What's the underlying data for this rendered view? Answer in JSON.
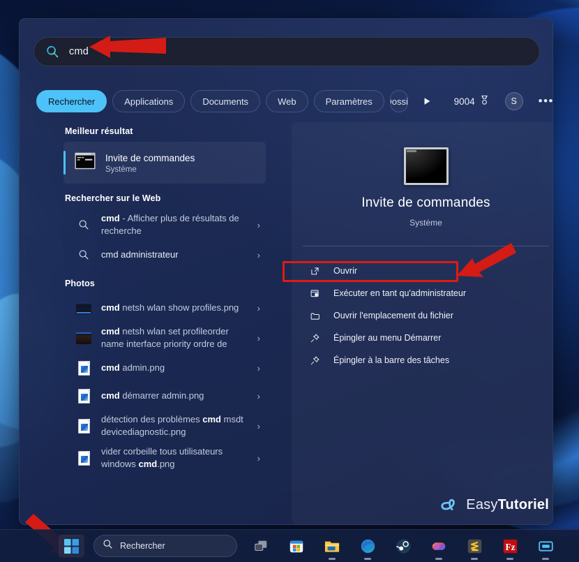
{
  "search": {
    "value": "cmd",
    "icon": "search-icon"
  },
  "tabs": [
    {
      "label": "Rechercher",
      "active": true
    },
    {
      "label": "Applications",
      "active": false
    },
    {
      "label": "Documents",
      "active": false
    },
    {
      "label": "Web",
      "active": false
    },
    {
      "label": "Paramètres",
      "active": false
    },
    {
      "label": "Dossiers",
      "active": false
    }
  ],
  "tabbar": {
    "next_icon": "play-arrow-icon",
    "rewards_points": "9004",
    "rewards_icon": "medal-icon",
    "avatar_initial": "S",
    "more_label": "•••"
  },
  "results": {
    "best_section_title": "Meilleur résultat",
    "best": {
      "title": "Invite de commandes",
      "subtitle": "Système",
      "icon": "command-prompt-icon"
    },
    "web_section_title": "Rechercher sur le Web",
    "web_items": [
      {
        "bold": "cmd",
        "rest": " - Afficher plus de résultats de recherche",
        "icon": "search-icon"
      },
      {
        "bold": "cmd administrateur",
        "rest": "",
        "icon": "search-icon"
      }
    ],
    "photos_section_title": "Photos",
    "photo_items": [
      {
        "bold": "cmd",
        "rest": " netsh wlan show profiles.png",
        "icon": "thumbnail-1"
      },
      {
        "bold": "cmd",
        "rest": " netsh wlan set profileorder name interface priority ordre de",
        "icon": "thumbnail-2"
      },
      {
        "bold": "cmd",
        "rest": " admin.png",
        "icon": "png-file-icon"
      },
      {
        "bold": "cmd",
        "rest": " démarrer admin.png",
        "icon": "png-file-icon"
      },
      {
        "bold": "",
        "rest": "détection des problèmes ",
        "bold2": "cmd",
        "rest2": " msdt devicediagnostic.png",
        "icon": "png-file-icon"
      },
      {
        "bold": "",
        "rest": "vider corbeille tous utilisateurs windows ",
        "bold2": "cmd",
        "rest2": ".png",
        "icon": "png-file-icon"
      }
    ],
    "chevron": "›"
  },
  "preview": {
    "app_icon": "command-prompt-large-icon",
    "title": "Invite de commandes",
    "subtitle": "Système",
    "actions": [
      {
        "label": "Ouvrir",
        "icon": "open-external-icon"
      },
      {
        "label": "Exécuter en tant qu'administrateur",
        "icon": "run-as-admin-icon"
      },
      {
        "label": "Ouvrir l'emplacement du fichier",
        "icon": "folder-icon"
      },
      {
        "label": "Épingler au menu Démarrer",
        "icon": "pin-icon"
      },
      {
        "label": "Épingler à la barre des tâches",
        "icon": "pin-icon"
      }
    ]
  },
  "watermark": {
    "logo": "et-logo-icon",
    "text_light": "Easy",
    "text_bold": "Tutoriel"
  },
  "taskbar": {
    "start_icon": "windows-start-icon",
    "search_placeholder": "Rechercher",
    "search_icon": "search-icon",
    "icons": [
      "task-view-icon",
      "microsoft-store-icon",
      "file-explorer-icon",
      "edge-icon",
      "steam-icon",
      "copilot-icon",
      "sublime-text-icon",
      "filezilla-icon",
      "terminal-icon"
    ]
  },
  "annotations": {
    "redbox_admin": "red-highlight-run-as-administrator",
    "redbox_start": "red-highlight-start-button",
    "arrow_search": "red-arrow-pointing-to-search-field",
    "arrow_admin": "red-arrow-pointing-to-run-as-administrator",
    "arrow_start": "red-arrow-pointing-to-start-button"
  },
  "colors": {
    "accent_cyan": "#4cc2f8",
    "annotation_red": "#e01b12",
    "panel_bg": "#202e58"
  }
}
